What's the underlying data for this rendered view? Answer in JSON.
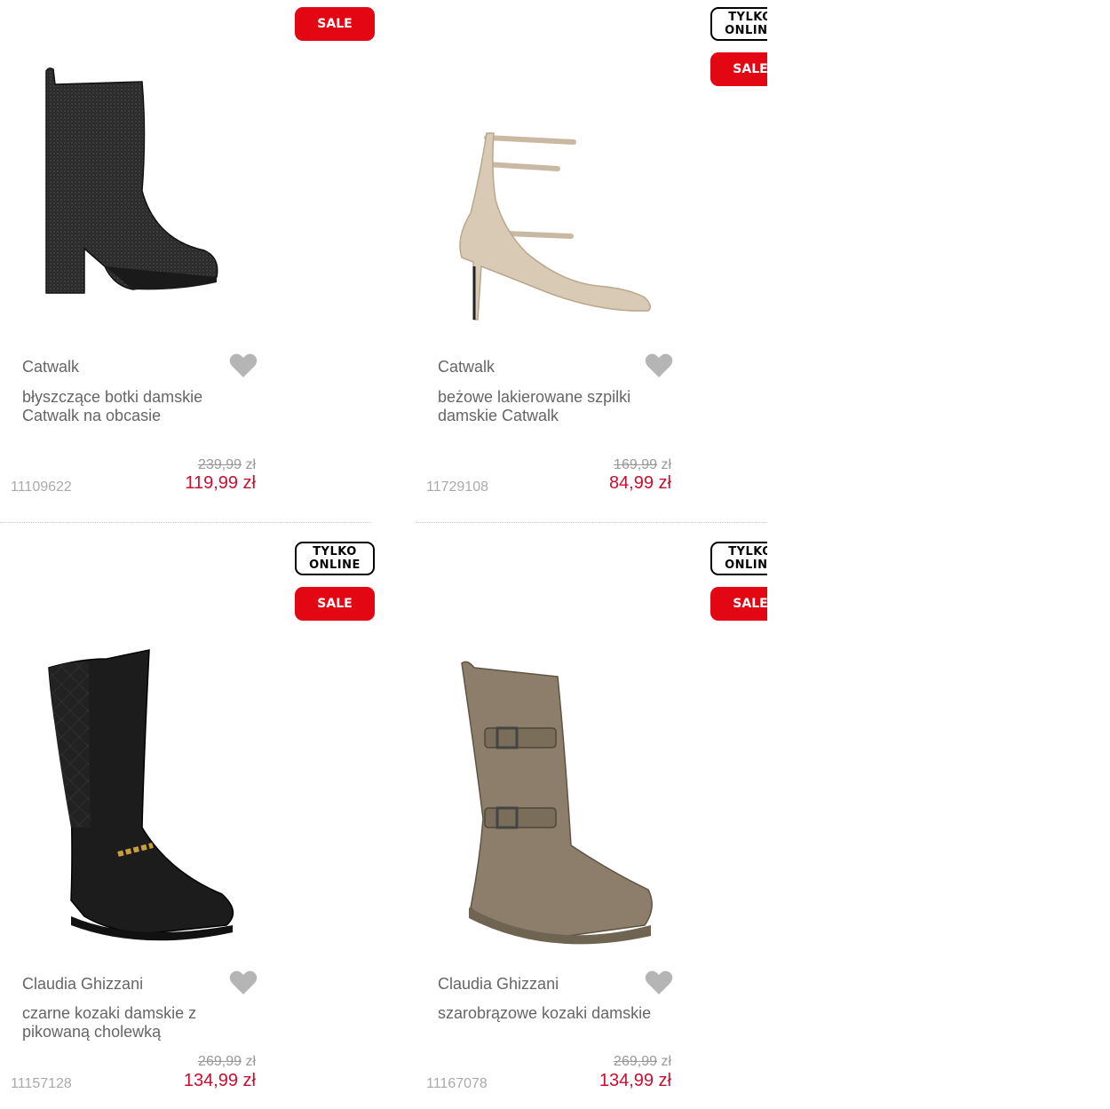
{
  "colors": {
    "sale_red": "#e30613",
    "price_red": "#c8102e",
    "heart_grey": "#b5b5b5"
  },
  "products": [
    {
      "badges": [
        "SALE"
      ],
      "brand": "Catwalk",
      "name": "błyszczące botki damskie Catwalk na obcasie",
      "sku": "11109622",
      "old_price": "239,99",
      "new_price": "119,99 zł",
      "currency": "zł",
      "image_icon": "black-glitter-platform-boot-image"
    },
    {
      "badges": [
        "TYLKO ONLINE",
        "SALE"
      ],
      "brand": "Catwalk",
      "name": "beżowe lakierowane szpilki damskie Catwalk",
      "sku": "11729108",
      "old_price": "169,99",
      "new_price": "84,99 zł",
      "currency": "zł",
      "image_icon": "beige-strappy-pump-image"
    },
    {
      "badges": [
        "TYLKO ONLINE",
        "SALE"
      ],
      "brand": "Claudia Ghizzani",
      "name": "czarne kozaki damskie z pikowaną cholewką",
      "sku": "11157128",
      "old_price": "269,99",
      "new_price": "134,99 zł",
      "currency": "zł",
      "image_icon": "black-quilted-knee-boot-image"
    },
    {
      "badges": [
        "TYLKO ONLINE",
        "SALE"
      ],
      "brand": "Claudia Ghizzani",
      "name": "szarobrązowe kozaki damskie",
      "sku": "11167078",
      "old_price": "269,99",
      "new_price": "134,99 zł",
      "currency": "zł",
      "image_icon": "taupe-combat-boot-image"
    }
  ],
  "badge_labels": {
    "online_line1": "TYLKO",
    "online_line2": "ONLINE",
    "sale": "SALE"
  }
}
